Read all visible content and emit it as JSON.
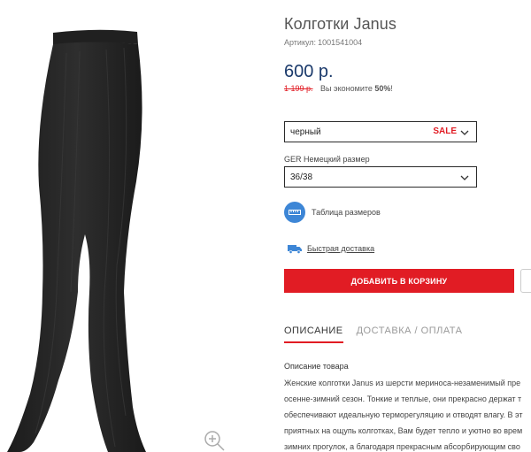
{
  "product": {
    "title": "Колготки Janus",
    "sku_label": "Артикул:",
    "sku": "1001541004",
    "price": "600 р.",
    "old_price": "1 199 р.",
    "savings_text": "Вы экономите",
    "savings_pct": "50%",
    "savings_end": "!"
  },
  "options": {
    "color_value": "черный",
    "color_badge": "SALE",
    "size_label": "GER Немецкий размер",
    "size_value": "36/38"
  },
  "links": {
    "size_table": "Таблица размеров",
    "delivery": "Быстрая доставка"
  },
  "actions": {
    "add_to_cart": "ДОБАВИТЬ В КОРЗИНУ"
  },
  "tabs": [
    {
      "label": "ОПИСАНИЕ"
    },
    {
      "label": "ДОСТАВКА / ОПЛАТА"
    }
  ],
  "description": {
    "heading": "Описание товара",
    "lines": [
      "Женские колготки Janus из шерсти мериноса-незаменимый пре",
      "осенне-зимний сезон. Тонкие и теплые, они прекрасно держат т",
      "обеспечивают идеальную терморегуляцию и отводят влагу. В эт",
      "приятных на ощупь колготках, Вам будет тепло и уютно во врем",
      "зимних прогулок, а благодаря прекрасным абсорбирующим сво"
    ]
  },
  "colors": {
    "accent_red": "#e11c24",
    "price_blue": "#1b3a6b",
    "icon_blue": "#3d86d6"
  },
  "icons": {
    "zoom": "zoom-in-icon",
    "chevron": "chevron-down-icon",
    "ruler": "ruler-icon",
    "truck": "truck-icon"
  }
}
